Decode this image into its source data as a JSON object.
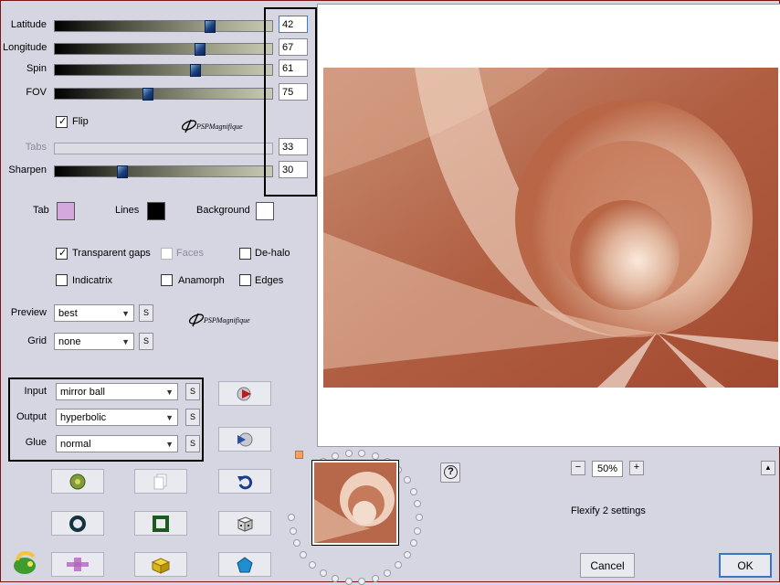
{
  "sliders": [
    {
      "label": "Latitude",
      "value": "42",
      "fraction": 0.72,
      "enabled": true,
      "focused": true
    },
    {
      "label": "Longitude",
      "value": "67",
      "fraction": 0.67,
      "enabled": true,
      "focused": false
    },
    {
      "label": "Spin",
      "value": "61",
      "fraction": 0.65,
      "enabled": true,
      "focused": false
    },
    {
      "label": "FOV",
      "value": "75",
      "fraction": 0.42,
      "enabled": true,
      "focused": false
    },
    {
      "label": "Tabs",
      "value": "33",
      "fraction": 0.0,
      "enabled": false,
      "focused": false
    },
    {
      "label": "Sharpen",
      "value": "30",
      "fraction": 0.3,
      "enabled": true,
      "focused": false
    }
  ],
  "flip": {
    "label": "Flip",
    "checked": true
  },
  "logo_text": "PSPMagnifique",
  "colors": {
    "tab": {
      "label": "Tab",
      "color": "#d4a8dc"
    },
    "lines": {
      "label": "Lines",
      "color": "#000000"
    },
    "background": {
      "label": "Background",
      "color": "#ffffff"
    }
  },
  "options": {
    "transparent_gaps": {
      "label": "Transparent gaps",
      "checked": true
    },
    "faces": {
      "label": "Faces",
      "checked": false
    },
    "de_halo": {
      "label": "De-halo",
      "checked": false
    },
    "indicatrix": {
      "label": "Indicatrix",
      "checked": false
    },
    "anamorph": {
      "label": "Anamorph",
      "checked": false
    },
    "edges": {
      "label": "Edges",
      "checked": false
    }
  },
  "preview_select": {
    "label": "Preview",
    "value": "best"
  },
  "grid_select": {
    "label": "Grid",
    "value": "none"
  },
  "input_select": {
    "label": "Input",
    "value": "mirror ball"
  },
  "output_select": {
    "label": "Output",
    "value": "hyperbolic"
  },
  "glue_select": {
    "label": "Glue",
    "value": "normal"
  },
  "s_label": "S",
  "zoom": {
    "value": "50%",
    "minus": "−",
    "plus": "+"
  },
  "help": "?",
  "settings_name": "Flexify 2 settings",
  "buttons": {
    "cancel": "Cancel",
    "ok": "OK"
  },
  "collapse": "▲",
  "accent_color": "#3a76c5"
}
